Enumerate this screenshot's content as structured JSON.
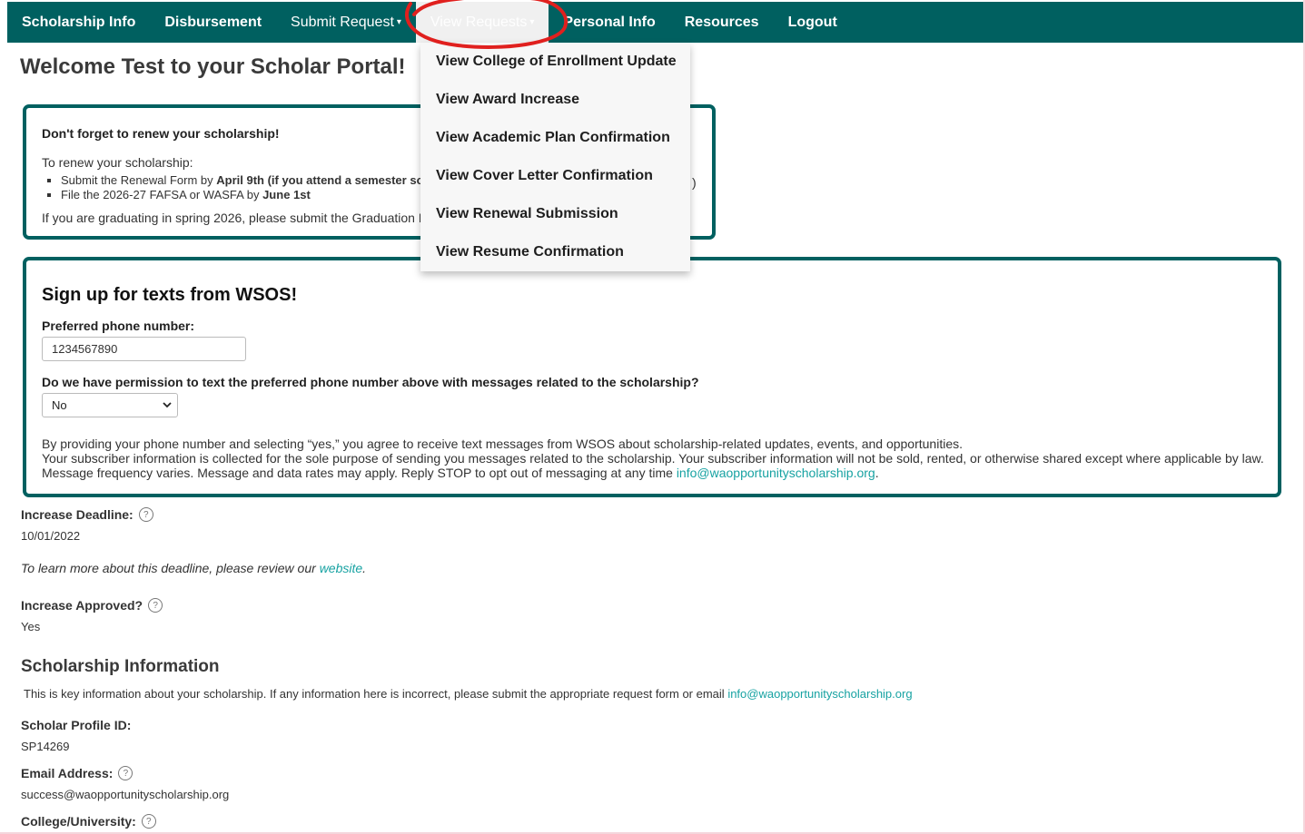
{
  "nav": {
    "items": [
      {
        "label": "Scholarship Info",
        "bold": true
      },
      {
        "label": "Disbursement",
        "bold": true
      },
      {
        "label": "Submit Request",
        "bold": false,
        "caret": true
      },
      {
        "label": "View Requests",
        "bold": false,
        "caret": true,
        "active": true
      },
      {
        "label": "Personal Info",
        "bold": true
      },
      {
        "label": "Resources",
        "bold": true
      },
      {
        "label": "Logout",
        "bold": true
      }
    ]
  },
  "dropdown": {
    "items": [
      "View College of Enrollment Update",
      "View Award Increase",
      "View Academic Plan Confirmation",
      "View Cover Letter Confirmation",
      "View Renewal Submission",
      "View Resume Confirmation"
    ]
  },
  "welcome": "Welcome Test to your Scholar Portal!",
  "renew": {
    "title": "Don't forget to renew your scholarship!",
    "intro": "To renew your scholarship:",
    "bullet1_a": "Submit the Renewal Form by ",
    "bullet1_b": "April 9th (if you attend a semester sc",
    "bullet2_a": "File the 2026-27 FAFSA or WASFA by ",
    "bullet2_b": "June 1st",
    "graduating": "If you are graduating in spring 2026, please submit the Graduation F",
    "tail": ")"
  },
  "sms": {
    "title": "Sign up for texts from WSOS!",
    "phone_label": "Preferred phone number:",
    "phone_value": "1234567890",
    "permission_label": "Do we have permission to text the preferred phone number above with messages related to the scholarship?",
    "permission_value": "No",
    "legal1": "By providing your phone number and selecting “yes,” you agree to receive text messages from WSOS about scholarship-related updates, events, and opportunities.",
    "legal2": "Your subscriber information is collected for the sole purpose of sending you messages related to the scholarship. Your subscriber information will not be sold, rented, or otherwise shared except where applicable by law.",
    "legal3": "Message frequency varies. Message and data rates may apply. Reply STOP to opt out of messaging at any time ",
    "email_link": "info@waopportunityscholarship.org",
    "legal3_end": "."
  },
  "increase_deadline": {
    "label": "Increase Deadline:",
    "value": "10/01/2022",
    "note": "To learn more about this deadline, please review our ",
    "note_link": "website",
    "note_end": "."
  },
  "increase_approved": {
    "label": "Increase Approved?",
    "value": "Yes"
  },
  "scholarship_info": {
    "heading": "Scholarship Information",
    "desc": "This is key information about your scholarship. If any information here is incorrect, please submit the appropriate request form or email ",
    "desc_link": "info@waopportunityscholarship.org",
    "profile_id_label": "Scholar Profile ID:",
    "profile_id_value": "SP14269",
    "email_label": "Email Address:",
    "email_value": "success@waopportunityscholarship.org",
    "college_label": "College/University:"
  },
  "icons": {
    "help": "?",
    "caret": "▾"
  },
  "colors": {
    "nav_bg": "#006060",
    "link": "#17a2a2",
    "annotation": "#e0201e"
  }
}
